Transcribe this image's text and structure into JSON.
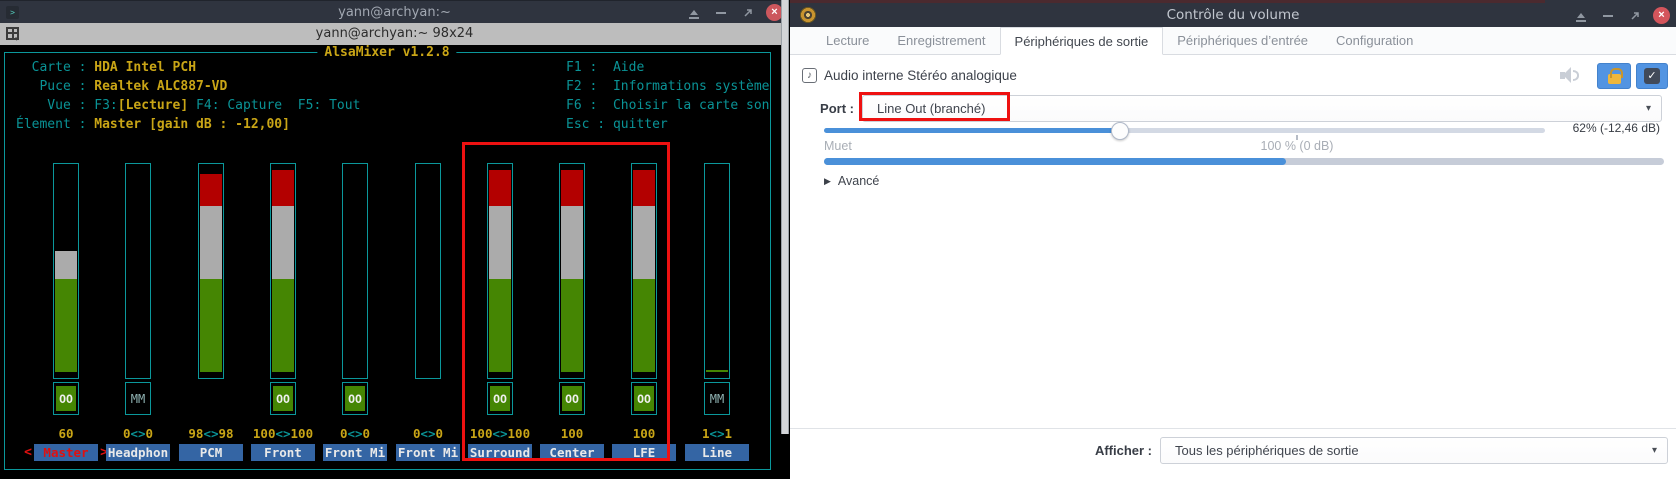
{
  "colors": {
    "accent_blue": "#5294e2",
    "meter_blue": "#4a90d9",
    "highlight_red": "#ee1111",
    "term_green": "#458603",
    "term_gray": "#ababab",
    "term_red": "#b30000",
    "term_teal": "#0a9396",
    "term_yellow": "#c9a516",
    "chip_blue": "#3465a4",
    "selected_red": "#e01010",
    "close_button_red": "#cc575d"
  },
  "icons": {
    "terminal_app": ">",
    "tab_caret": "▾",
    "device_note": "♪",
    "check": "✓",
    "close": "×",
    "dropdown_caret": "▾",
    "expander": "▶"
  },
  "terminal": {
    "title": "yann@archyan:~",
    "tab_title": "yann@archyan:~ 98x24",
    "mixer": {
      "title": "AlsaMixer v1.2.8",
      "info": {
        "card_label": "  Carte : ",
        "card_value": "HDA Intel PCH",
        "chip_label": "   Puce : ",
        "chip_value": "Realtek ALC887-VD",
        "view_label": "    Vue : ",
        "view_prefix": "F3:",
        "view_value": "[Lecture]",
        "view_suffix": " F4: Capture  F5: Tout",
        "item_label": "Élement : ",
        "item_value": "Master [gain dB : -12,00]"
      },
      "keys": [
        "F1 :  Aide",
        "F2 :  Informations système",
        "F6 :  Choisir la carte son",
        "Esc : quitter"
      ],
      "selection_arrows": {
        "left": "<",
        "right": ">"
      },
      "channels": [
        {
          "name": "Master",
          "value": "60",
          "switch": "OO",
          "fill": 60,
          "selected": true
        },
        {
          "name": "Headphon",
          "value": "0<>0",
          "switch": "MM",
          "fill": 0,
          "selected": false
        },
        {
          "name": "PCM",
          "value": "98<>98",
          "switch": null,
          "fill": 98,
          "selected": false
        },
        {
          "name": "Front",
          "value": "100<>100",
          "switch": "OO",
          "fill": 100,
          "selected": false
        },
        {
          "name": "Front Mi",
          "value": "0<>0",
          "switch": "OO",
          "fill": 0,
          "selected": false
        },
        {
          "name": "Front Mi",
          "value": "0<>0",
          "switch": null,
          "fill": 0,
          "selected": false
        },
        {
          "name": "Surround",
          "value": "100<>100",
          "switch": "OO",
          "fill": 100,
          "selected": false
        },
        {
          "name": "Center",
          "value": "100",
          "switch": "OO",
          "fill": 100,
          "selected": false
        },
        {
          "name": "LFE",
          "value": "100",
          "switch": "OO",
          "fill": 100,
          "selected": false
        },
        {
          "name": "Line",
          "value": "1<>1",
          "switch": "MM",
          "fill": 1,
          "selected": false
        }
      ]
    }
  },
  "volume_control": {
    "title": "Contrôle du volume",
    "tabs": [
      {
        "id": "lecture",
        "label": "Lecture",
        "active": false
      },
      {
        "id": "enregistrement",
        "label": "Enregistrement",
        "active": false
      },
      {
        "id": "peripheriques-de-sortie",
        "label": "Périphériques de sortie",
        "active": true
      },
      {
        "id": "peripheriques-d-entree",
        "label": "Périphériques d’entrée",
        "active": false
      },
      {
        "id": "configuration",
        "label": "Configuration",
        "active": false
      }
    ],
    "device": {
      "name": "Audio interne Stéréo analogique"
    },
    "port": {
      "label": "Port :",
      "value": "Line Out (branché)"
    },
    "volume": {
      "value_label": "62% (-12,46 dB)",
      "percent": 62,
      "mute_label": "Muet",
      "reference_label": "100 % (0 dB)"
    },
    "advanced": {
      "label": "Avancé"
    },
    "footer": {
      "label": "Afficher :",
      "value": "Tous les périphériques de sortie"
    }
  }
}
